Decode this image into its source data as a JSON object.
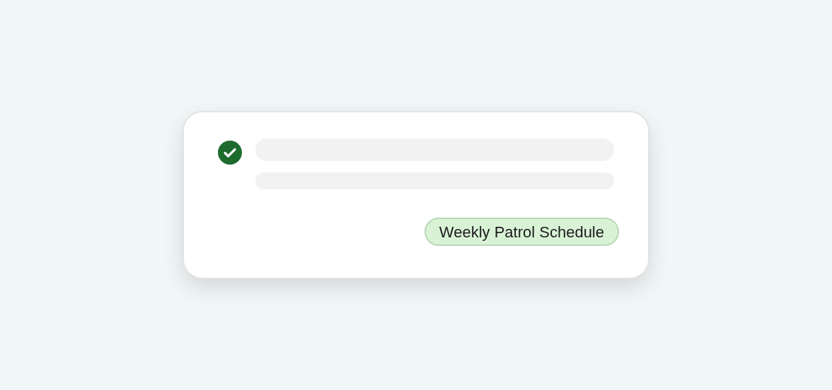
{
  "card": {
    "completed": true,
    "tag": "Weekly Patrol Schedule"
  }
}
